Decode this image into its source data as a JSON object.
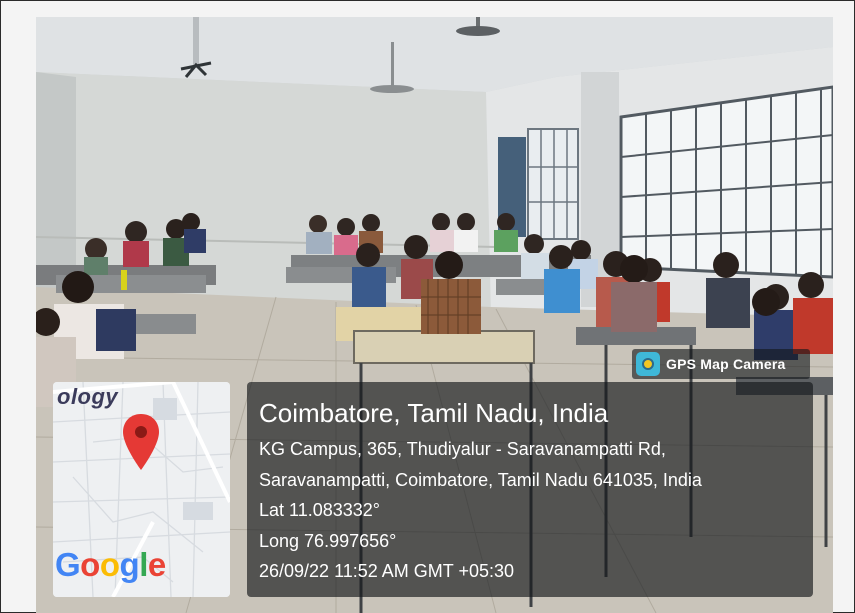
{
  "badge": {
    "label": "GPS Map Camera",
    "icon": "gps-map-camera-icon"
  },
  "map": {
    "partial_label": "ology",
    "logo_text": "Google",
    "logo_colors": [
      "#4285F4",
      "#EA4335",
      "#FBBC05",
      "#4285F4",
      "#34A853",
      "#EA4335"
    ],
    "pin_color": "#e53935",
    "icon": "map-pin-icon"
  },
  "location": {
    "city": "Coimbatore, Tamil Nadu, India",
    "address_line1": "KG Campus, 365, Thudiyalur - Saravanampatti Rd,",
    "address_line2": "Saravanampatti, Coimbatore, Tamil Nadu 641035, India",
    "lat": "Lat 11.083332°",
    "long": "Long 76.997656°",
    "datetime": "26/09/22 11:52 AM GMT +05:30"
  }
}
